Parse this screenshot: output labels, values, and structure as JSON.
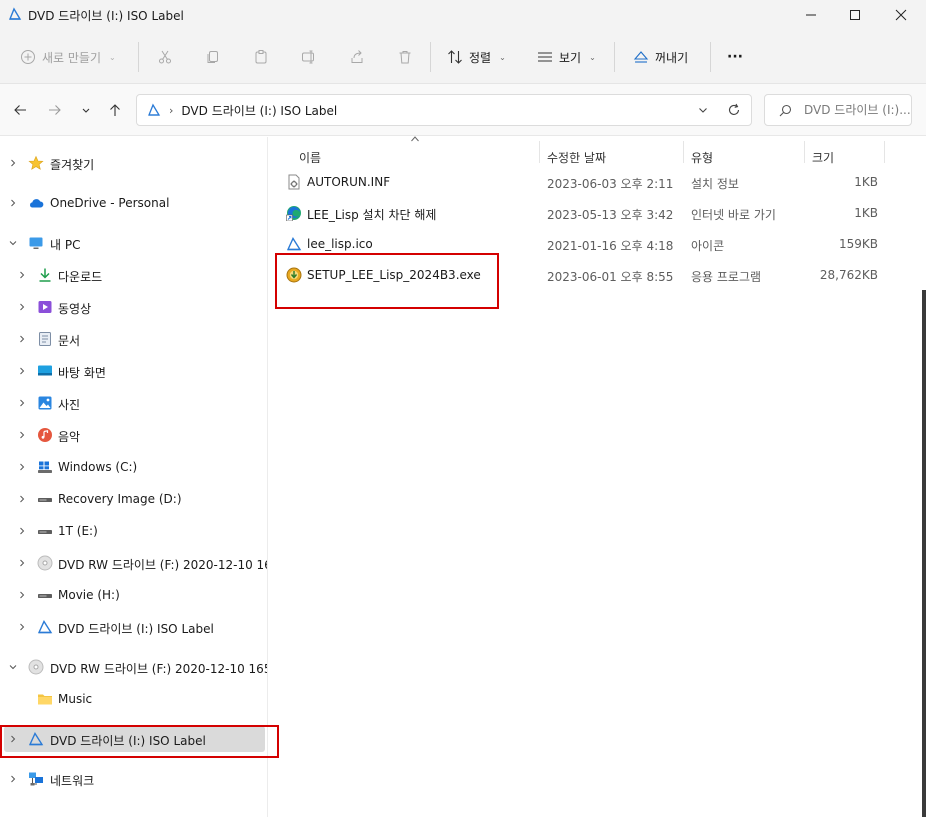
{
  "window": {
    "title": "DVD 드라이브 (I:) ISO Label",
    "icon": "dvd-drive-icon"
  },
  "toolbar": {
    "new_label": "새로 만들기",
    "sort_label": "정렬",
    "view_label": "보기",
    "eject_label": "꺼내기",
    "more_label": "···"
  },
  "address": {
    "path": "DVD 드라이브 (I:) ISO Label",
    "search_placeholder": "DVD 드라이브 (I:)..."
  },
  "sidebar": {
    "items": [
      {
        "label": "즐겨찾기",
        "icon": "star-icon"
      },
      {
        "label": "OneDrive - Personal",
        "icon": "cloud-icon"
      },
      {
        "label": "내 PC",
        "icon": "monitor-icon"
      },
      {
        "label": "다운로드",
        "icon": "download-icon"
      },
      {
        "label": "동영상",
        "icon": "video-icon"
      },
      {
        "label": "문서",
        "icon": "document-icon"
      },
      {
        "label": "바탕 화면",
        "icon": "desktop-icon"
      },
      {
        "label": "사진",
        "icon": "picture-icon"
      },
      {
        "label": "음악",
        "icon": "music-icon"
      },
      {
        "label": "Windows (C:)",
        "icon": "windows-drive-icon"
      },
      {
        "label": "Recovery Image (D:)",
        "icon": "drive-icon"
      },
      {
        "label": "1T (E:)",
        "icon": "drive-icon"
      },
      {
        "label": "DVD RW 드라이브 (F:) 2020-12-10 16",
        "icon": "disc-icon"
      },
      {
        "label": "Movie (H:)",
        "icon": "drive-icon"
      },
      {
        "label": "DVD 드라이브 (I:) ISO Label",
        "icon": "dvd-drive-icon"
      },
      {
        "label": "DVD RW 드라이브 (F:) 2020-12-10 165",
        "icon": "disc-icon"
      },
      {
        "label": "Music",
        "icon": "folder-icon"
      },
      {
        "label": "DVD 드라이브 (I:) ISO Label",
        "icon": "dvd-drive-icon",
        "selected": true
      },
      {
        "label": "네트워크",
        "icon": "network-icon"
      }
    ]
  },
  "columns": {
    "name": "이름",
    "date": "수정한 날짜",
    "type": "유형",
    "size": "크기"
  },
  "files": [
    {
      "name": "AUTORUN.INF",
      "date": "2023-06-03 오후 2:11",
      "type": "설치 정보",
      "size": "1KB",
      "icon": "settings-file-icon"
    },
    {
      "name": "LEE_Lisp 설치 차단 해제",
      "date": "2023-05-13 오후 3:42",
      "type": "인터넷 바로 가기",
      "size": "1KB",
      "icon": "edge-shortcut-icon"
    },
    {
      "name": "lee_lisp.ico",
      "date": "2021-01-16 오후 4:18",
      "type": "아이콘",
      "size": "159KB",
      "icon": "ico-file-icon"
    },
    {
      "name": "SETUP_LEE_Lisp_2024B3.exe",
      "date": "2023-06-01 오후 8:55",
      "type": "응용 프로그램",
      "size": "28,762KB",
      "icon": "installer-icon"
    }
  ]
}
